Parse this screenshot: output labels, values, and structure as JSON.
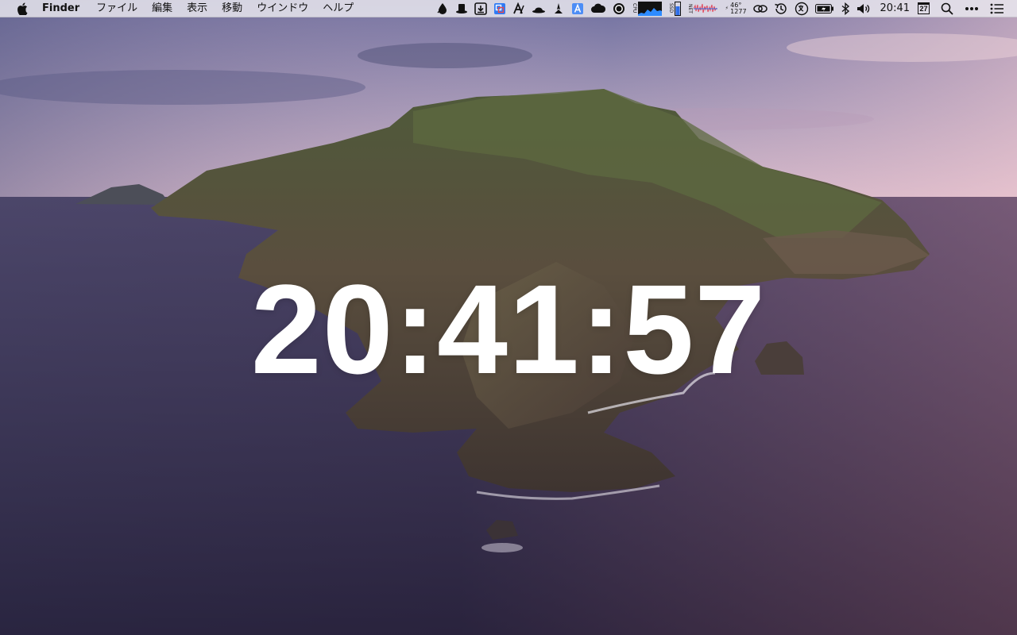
{
  "menubar": {
    "app_name": "Finder",
    "menus": [
      "ファイル",
      "編集",
      "表示",
      "移動",
      "ウインドウ",
      "ヘルプ"
    ],
    "status_items": [
      "drop-icon",
      "hat-icon",
      "download-box-icon",
      "screen-capture-icon",
      "font-a-icon",
      "bowler-hat-icon",
      "launch-icon",
      "text-a-icon",
      "cloud-icon",
      "record-circle-icon",
      "cpu-graph-icon",
      "battery-meter-icon",
      "network-graph-icon",
      "thermometer-stats-icon",
      "link-icon",
      "time-machine-icon",
      "translate-icon",
      "battery-icon",
      "bluetooth-icon",
      "volume-icon",
      "calendar-icon",
      "spotlight-search-icon",
      "more-icon",
      "notification-center-icon"
    ],
    "stats_text": {
      "temp": "46°",
      "value": "1277"
    },
    "cpu_label": "CPU",
    "ssd_label": "SSD",
    "net_label": "NET",
    "clock": "20:41",
    "calendar_day": "27"
  },
  "desktop": {
    "big_clock": "20:41:57"
  },
  "colors": {
    "menubar_bg": "#ECEAF0",
    "sky_top": "#7A7AA5",
    "sky_horizon": "#D9B8C8",
    "sea_left": "#2A2A44",
    "sea_right": "#8A5A6A",
    "clock_text": "#FFFFFF"
  }
}
